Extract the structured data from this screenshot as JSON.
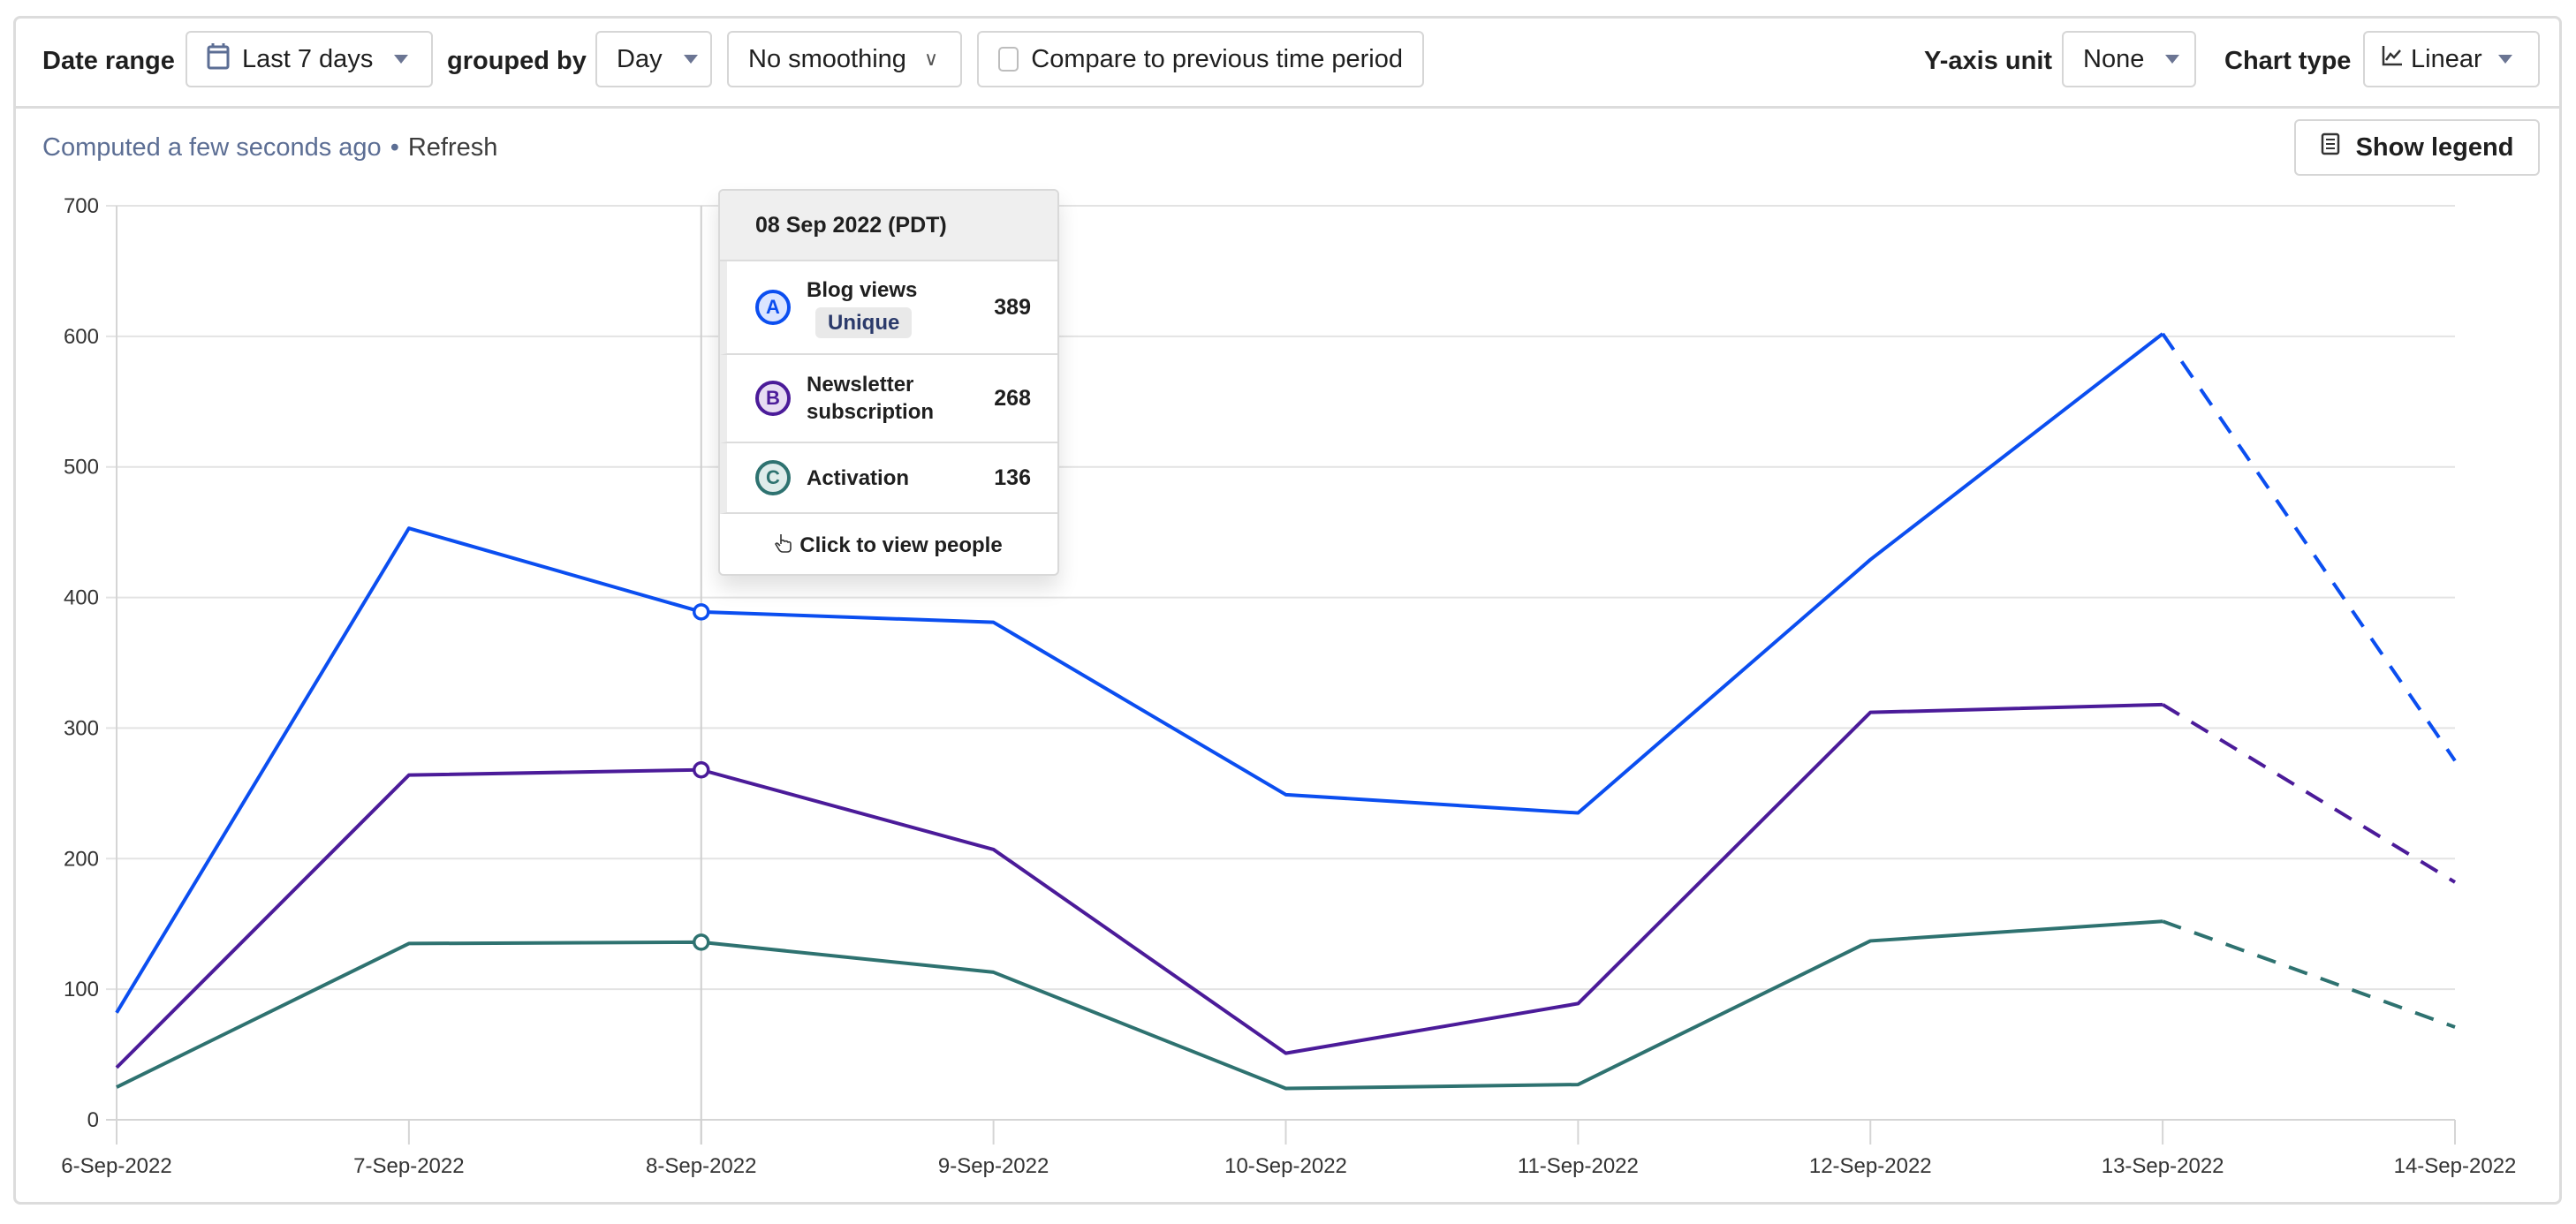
{
  "toolbar": {
    "date_range_label": "Date range",
    "date_range_value": "Last 7 days",
    "grouped_by_label": "grouped by",
    "interval_value": "Day",
    "smoothing_value": "No smoothing",
    "compare_label": "Compare to previous time period",
    "compare_checked": false,
    "y_axis_unit_label": "Y-axis unit",
    "y_axis_unit_value": "None",
    "chart_type_label": "Chart type",
    "chart_type_value": "Linear"
  },
  "status": {
    "computed": "Computed a few seconds ago",
    "separator": "•",
    "refresh": "Refresh"
  },
  "show_legend_label": "Show legend",
  "tooltip": {
    "title": "08 Sep 2022 (PDT)",
    "rows": [
      {
        "badge": "A",
        "name": "Blog views",
        "tag": "Unique",
        "value": "389"
      },
      {
        "badge": "B",
        "name": "Newsletter subscription",
        "tag": "",
        "value": "268"
      },
      {
        "badge": "C",
        "name": "Activation",
        "tag": "",
        "value": "136"
      }
    ],
    "footer": "Click to view people"
  },
  "colors": {
    "blog_views": "#0b4ef0",
    "newsletter": "#4b1b99",
    "activation": "#2e7270",
    "grid": "#e3e3e3"
  },
  "chart_data": {
    "type": "line",
    "title": "",
    "xlabel": "",
    "ylabel": "",
    "categories": [
      "6-Sep-2022",
      "7-Sep-2022",
      "8-Sep-2022",
      "9-Sep-2022",
      "10-Sep-2022",
      "11-Sep-2022",
      "12-Sep-2022",
      "13-Sep-2022",
      "14-Sep-2022"
    ],
    "ylim": [
      0,
      700
    ],
    "yticks": [
      0,
      100,
      200,
      300,
      400,
      500,
      600,
      700
    ],
    "grid": true,
    "legend": "hidden",
    "hover_index": 2,
    "incomplete_from_index": 7,
    "series": [
      {
        "name": "Blog views",
        "badge": "A",
        "color": "#0b4ef0",
        "values": [
          82,
          453,
          389,
          381,
          249,
          235,
          429,
          602,
          275
        ]
      },
      {
        "name": "Newsletter subscription",
        "badge": "B",
        "color": "#4b1b99",
        "values": [
          40,
          264,
          268,
          207,
          51,
          89,
          312,
          318,
          182
        ]
      },
      {
        "name": "Activation",
        "badge": "C",
        "color": "#2e7270",
        "values": [
          25,
          135,
          136,
          113,
          24,
          27,
          137,
          152,
          71
        ]
      }
    ]
  }
}
